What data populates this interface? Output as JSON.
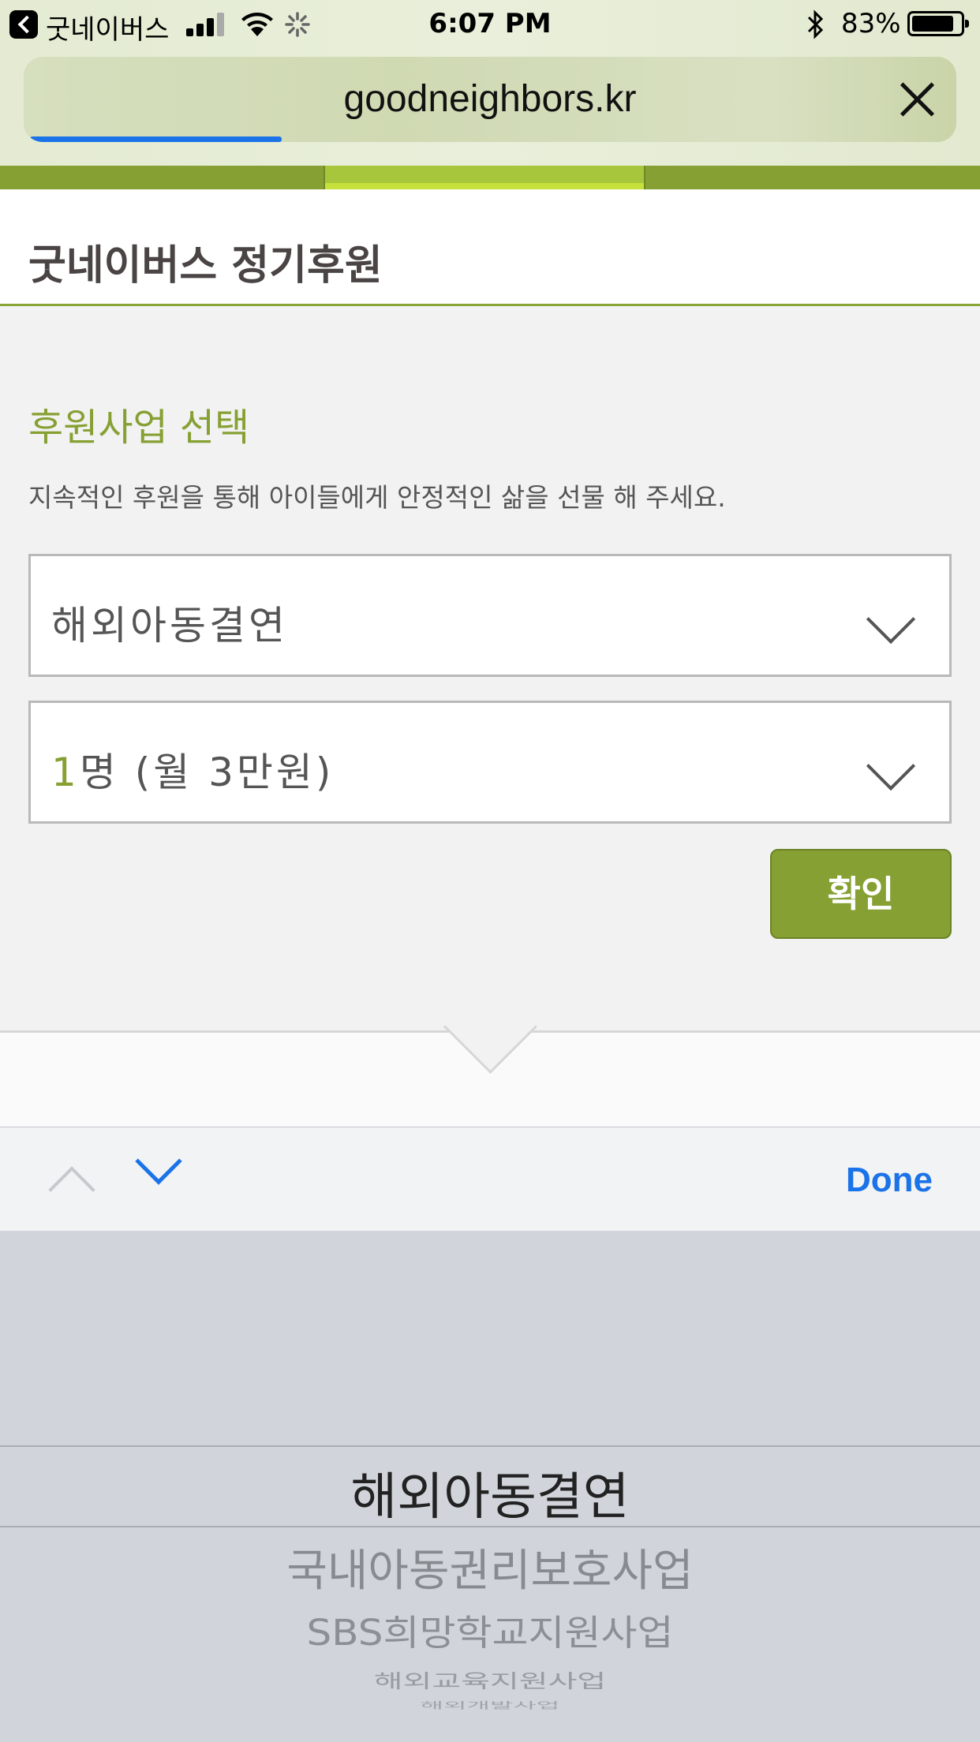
{
  "status_bar": {
    "back_app": "굿네이버스",
    "time": "6:07 PM",
    "battery": "83%"
  },
  "browser": {
    "url": "goodneighbors.kr",
    "load_progress": 0.27
  },
  "page": {
    "title": "굿네이버스 정기후원",
    "section_title": "후원사업 선택",
    "section_desc": "지속적인 후원을 통해 아이들에게 안정적인 삶을 선물 해 주세요.",
    "program_select": {
      "value": "해외아동결연"
    },
    "amount_select": {
      "count": "1",
      "rest": "명 (월 3만원)"
    },
    "confirm_label": "확인"
  },
  "keyboard_accessory": {
    "done_label": "Done"
  },
  "picker": {
    "selected": "해외아동결연",
    "options": [
      "국내아동권리보호사업",
      "SBS희망학교지원사업",
      "해외교육지원사업",
      "해외개발사업"
    ]
  },
  "colors": {
    "brand_green": "#86a033",
    "ios_blue": "#1a73e8"
  }
}
